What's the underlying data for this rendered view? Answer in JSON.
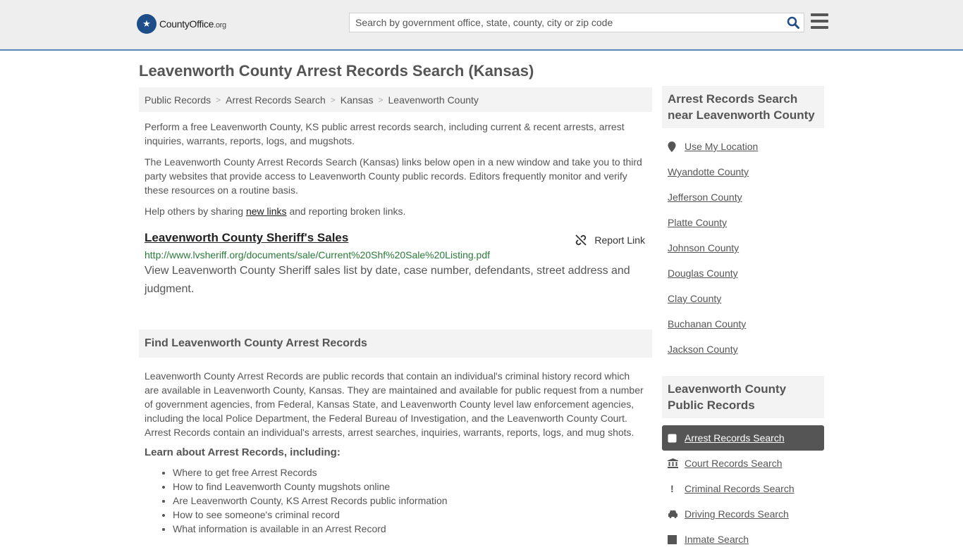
{
  "header": {
    "logo_text": "CountyOffice",
    "logo_suffix": ".org",
    "search_placeholder": "Search by government office, state, county, city or zip code"
  },
  "page_title": "Leavenworth County Arrest Records Search (Kansas)",
  "breadcrumb": [
    "Public Records",
    "Arrest Records Search",
    "Kansas",
    "Leavenworth County"
  ],
  "intro": {
    "p1": "Perform a free Leavenworth County, KS public arrest records search, including current & recent arrests, arrest inquiries, warrants, reports, logs, and mugshots.",
    "p2": "The Leavenworth County Arrest Records Search (Kansas) links below open in a new window and take you to third party websites that provide access to Leavenworth County public records. Editors frequently monitor and verify these resources on a routine basis.",
    "p3_before": "Help others by sharing ",
    "p3_link": "new links",
    "p3_after": " and reporting broken links."
  },
  "record": {
    "title": "Leavenworth County Sheriff's Sales",
    "report_label": "Report Link",
    "url": "http://www.lvsheriff.org/documents/sale/Current%20Shf%20Sale%20Listing.pdf",
    "description": "View Leavenworth County Sheriff sales list by date, case number, defendants, street address and judgment."
  },
  "find_section": {
    "heading": "Find Leavenworth County Arrest Records",
    "body": "Leavenworth County Arrest Records are public records that contain an individual's criminal history record which are available in Leavenworth County, Kansas. They are maintained and available for public request from a number of government agencies, from Federal, Kansas State, and Leavenworth County level law enforcement agencies, including the local Police Department, the Federal Bureau of Investigation, and the Leavenworth County Court. Arrest Records contain an individual's arrests, arrest searches, inquiries, warrants, reports, logs, and mug shots.",
    "learn_heading": "Learn about Arrest Records, including:",
    "bullets": [
      "Where to get free Arrest Records",
      "How to find Leavenworth County mugshots online",
      "Are Leavenworth County, KS Arrest Records public information",
      "How to see someone's criminal record",
      "What information is available in an Arrest Record"
    ]
  },
  "sidebar": {
    "nearby_heading": "Arrest Records Search near Leavenworth County",
    "use_location": "Use My Location",
    "nearby": [
      "Wyandotte County",
      "Jefferson County",
      "Platte County",
      "Johnson County",
      "Douglas County",
      "Clay County",
      "Buchanan County",
      "Jackson County"
    ],
    "public_heading": "Leavenworth County Public Records",
    "public_items": [
      {
        "label": "Arrest Records Search",
        "icon": "square-icon",
        "active": true
      },
      {
        "label": "Court Records Search",
        "icon": "courthouse-icon",
        "active": false
      },
      {
        "label": "Criminal Records Search",
        "icon": "exclamation-icon",
        "active": false
      },
      {
        "label": "Driving Records Search",
        "icon": "car-icon",
        "active": false
      },
      {
        "label": "Inmate Search",
        "icon": "inmate-icon",
        "active": false
      }
    ]
  }
}
